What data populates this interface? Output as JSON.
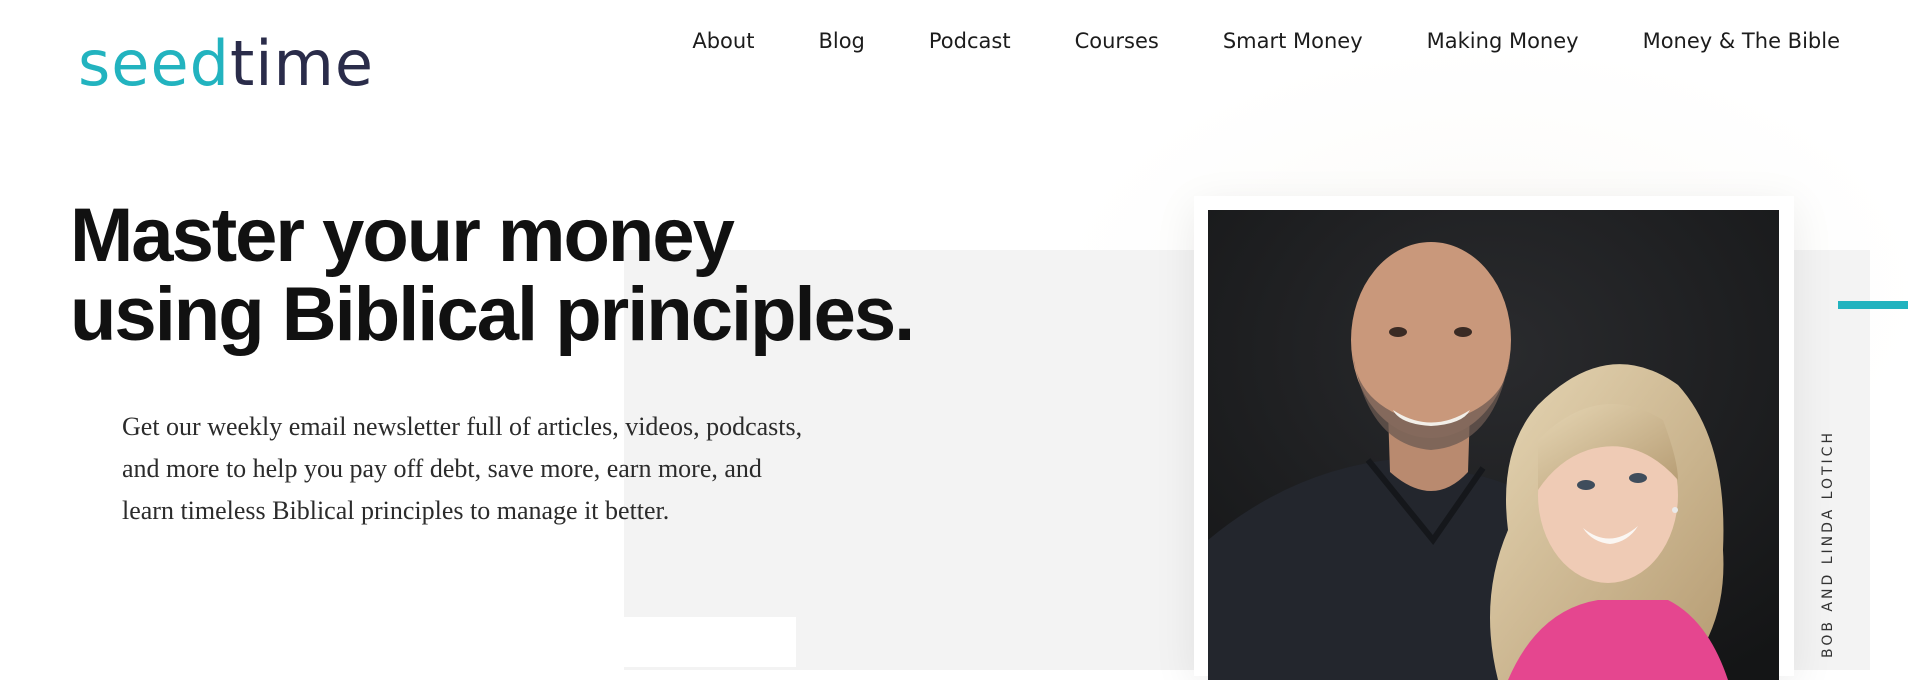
{
  "logo": {
    "part1": "seed",
    "part2": "time"
  },
  "nav": {
    "items": [
      {
        "label": "About"
      },
      {
        "label": "Blog"
      },
      {
        "label": "Podcast"
      },
      {
        "label": "Courses"
      },
      {
        "label": "Smart Money"
      },
      {
        "label": "Making Money"
      },
      {
        "label": "Money & The Bible"
      }
    ]
  },
  "hero": {
    "headline_line1": "Master your money",
    "headline_line2": "using Biblical principles.",
    "intro": "Get our weekly email newsletter full of articles, videos, podcasts, and more to help you pay off debt, save more, earn more, and learn timeless Biblical principles to manage it better."
  },
  "photo": {
    "caption": "BOB AND LINDA LOTICH"
  },
  "colors": {
    "accent": "#22b3bf",
    "logo_dark": "#2a2c4a",
    "text": "#111111"
  }
}
